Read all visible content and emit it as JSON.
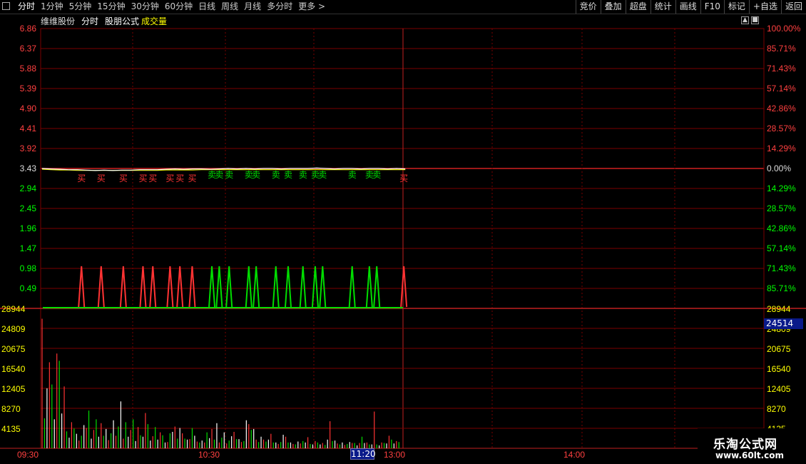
{
  "toolbar": {
    "tabs": [
      "分时",
      "1分钟",
      "5分钟",
      "15分钟",
      "30分钟",
      "60分钟",
      "日线",
      "周线",
      "月线",
      "多分时",
      "更多 >"
    ],
    "right_buttons": [
      "竞价",
      "叠加",
      "超盘",
      "统计",
      "画线",
      "F10",
      "标记",
      "+自选",
      "返回"
    ]
  },
  "title": {
    "stock": "维维股份",
    "mode": "分时",
    "formula": "股朋公式",
    "volume_label": "成交量"
  },
  "colors": {
    "up": "#ff3333",
    "down": "#00dd00",
    "price_line": "#ffffff",
    "avg_line": "#e8e800",
    "grid": "#7a0000",
    "axis_text_up": "#ff4040",
    "axis_text_down": "#00ff00",
    "volume_axis": "#ffff00"
  },
  "price_axis": {
    "left_labels": [
      "6.86",
      "6.37",
      "5.88",
      "5.39",
      "4.90",
      "4.41",
      "3.92",
      "3.43",
      "2.94",
      "2.45",
      "1.96",
      "1.47",
      "0.98",
      "0.49"
    ],
    "right_labels": [
      "100.00%",
      "85.71%",
      "71.43%",
      "57.14%",
      "42.86%",
      "28.57%",
      "14.29%",
      "0.00%",
      "14.29%",
      "28.57%",
      "42.86%",
      "57.14%",
      "71.43%",
      "85.71%"
    ],
    "base": 3.43
  },
  "volume_axis": {
    "labels": [
      "28944",
      "24809",
      "20675",
      "16540",
      "12405",
      "8270",
      "4135"
    ],
    "current_marker": "24514"
  },
  "time_axis": {
    "labels": [
      "09:30",
      "10:30",
      "13:00",
      "14:00"
    ],
    "cursor_label": "11:20"
  },
  "chart_data": {
    "type": "line",
    "price": [
      3.43,
      3.42,
      3.41,
      3.4,
      3.4,
      3.39,
      3.38,
      3.39,
      3.38,
      3.39,
      3.39,
      3.4,
      3.4,
      3.4,
      3.41,
      3.42,
      3.41,
      3.42,
      3.42,
      3.41,
      3.42,
      3.43,
      3.42,
      3.43,
      3.42,
      3.43,
      3.43,
      3.42,
      3.43,
      3.43,
      3.43,
      3.44,
      3.43,
      3.42,
      3.43,
      3.43,
      3.42,
      3.43,
      3.43,
      3.42,
      3.43,
      3.42
    ],
    "avg_price": [
      3.43,
      3.42,
      3.41,
      3.41,
      3.4,
      3.4,
      3.4,
      3.4,
      3.4,
      3.4,
      3.4,
      3.4,
      3.4,
      3.4,
      3.41,
      3.41,
      3.41,
      3.41,
      3.42,
      3.42,
      3.42,
      3.42,
      3.42,
      3.42,
      3.42,
      3.42,
      3.42,
      3.42,
      3.42,
      3.42,
      3.42,
      3.42,
      3.42,
      3.42,
      3.42,
      3.42,
      3.42,
      3.42,
      3.42,
      3.42,
      3.42,
      3.42
    ],
    "signals": [
      {
        "label": "买",
        "type": "buy",
        "minute": 16
      },
      {
        "label": "买",
        "type": "buy",
        "minute": 24
      },
      {
        "label": "买",
        "type": "buy",
        "minute": 33
      },
      {
        "label": "买",
        "type": "buy",
        "minute": 41
      },
      {
        "label": "买",
        "type": "buy",
        "minute": 45
      },
      {
        "label": "买",
        "type": "buy",
        "minute": 52
      },
      {
        "label": "买",
        "type": "buy",
        "minute": 56
      },
      {
        "label": "买",
        "type": "buy",
        "minute": 61
      },
      {
        "label": "卖",
        "type": "sell",
        "minute": 69
      },
      {
        "label": "卖",
        "type": "sell",
        "minute": 72
      },
      {
        "label": "卖",
        "type": "sell",
        "minute": 76
      },
      {
        "label": "卖",
        "type": "sell",
        "minute": 84
      },
      {
        "label": "卖",
        "type": "sell",
        "minute": 87
      },
      {
        "label": "卖",
        "type": "sell",
        "minute": 95
      },
      {
        "label": "卖",
        "type": "sell",
        "minute": 100
      },
      {
        "label": "卖",
        "type": "sell",
        "minute": 106
      },
      {
        "label": "卖",
        "type": "sell",
        "minute": 111
      },
      {
        "label": "卖",
        "type": "sell",
        "minute": 114
      },
      {
        "label": "卖",
        "type": "sell",
        "minute": 126
      },
      {
        "label": "卖",
        "type": "sell",
        "minute": 133
      },
      {
        "label": "卖",
        "type": "sell",
        "minute": 136
      },
      {
        "label": "买",
        "type": "buy",
        "minute": 147
      }
    ],
    "volume": [
      26800,
      6200,
      12400,
      17800,
      13200,
      6000,
      19600,
      18100,
      7200,
      12800,
      3500,
      2200,
      5400,
      4100,
      3000,
      1600,
      2600,
      4800,
      4200,
      7800,
      2000,
      3800,
      6000,
      2400,
      5200,
      2600,
      4000,
      1700,
      3100,
      5800,
      2600,
      4500,
      9700,
      2000,
      5400,
      2400,
      3800,
      6000,
      1500,
      4400,
      2700,
      2400,
      7300,
      5000,
      1600,
      2500,
      4400,
      1800,
      3300,
      2700,
      1200,
      1300,
      3100,
      3400,
      4500,
      2000,
      4200,
      3100,
      2000,
      1800,
      1900,
      4200,
      2600,
      1400,
      1200,
      1600,
      1200,
      3300,
      2100,
      4000,
      1800,
      5200,
      1200,
      2200,
      3300,
      1000,
      1600,
      2500,
      3400,
      1900,
      1900,
      1300,
      1500,
      5800,
      5000,
      3800,
      4000,
      1800,
      1300,
      2400,
      1800,
      1400,
      1800,
      3000,
      1200,
      1200,
      900,
      1300,
      2800,
      2400,
      1200,
      1200,
      900,
      800,
      1400,
      1000,
      1500,
      1200,
      2300,
      900,
      800,
      1500,
      1200,
      800,
      1100,
      700,
      1800,
      5600,
      1500,
      1600,
      1000,
      800,
      1200,
      700,
      900,
      1300,
      1100,
      1100,
      600,
      1100,
      2400,
      1100,
      1200,
      800,
      800,
      7600,
      800,
      600,
      1200,
      1100,
      1000,
      2600,
      1800,
      1000,
      1500,
      1300
    ],
    "volume_colors": "mixed red/green/white by minute",
    "xlim": [
      "09:30",
      "15:00"
    ],
    "ylim": [
      0.49,
      6.86
    ],
    "volume_ylim": [
      0,
      28944
    ]
  }
}
